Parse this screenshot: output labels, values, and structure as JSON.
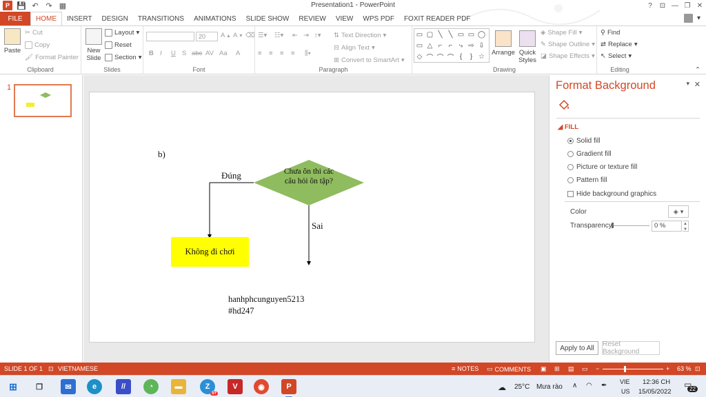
{
  "window": {
    "title": "Presentation1 - PowerPoint",
    "logo_letter": "P",
    "controls": [
      "?",
      "⊡",
      "—",
      "❐",
      "✕"
    ]
  },
  "quick_access": [
    "💾",
    "↶",
    "↷",
    "▦"
  ],
  "tabs": [
    "FILE",
    "HOME",
    "INSERT",
    "DESIGN",
    "TRANSITIONS",
    "ANIMATIONS",
    "SLIDE SHOW",
    "REVIEW",
    "VIEW",
    "WPS PDF",
    "FOXIT READER PDF"
  ],
  "active_tab": "HOME",
  "ribbon": {
    "clipboard": {
      "label": "Clipboard",
      "paste": "Paste",
      "cut": "Cut",
      "copy": "Copy",
      "format_painter": "Format Painter"
    },
    "slides": {
      "label": "Slides",
      "new_slide": "New Slide",
      "layout": "Layout",
      "reset": "Reset",
      "section": "Section"
    },
    "font": {
      "label": "Font",
      "size": "20",
      "buttons": [
        "B",
        "I",
        "U",
        "S",
        "abc",
        "AV",
        "Aa",
        "A"
      ]
    },
    "paragraph": {
      "label": "Paragraph",
      "text_direction": "Text Direction",
      "align_text": "Align Text",
      "smartart": "Convert to SmartArt"
    },
    "drawing": {
      "label": "Drawing",
      "arrange": "Arrange",
      "quick_styles": "Quick Styles",
      "shape_fill": "Shape Fill",
      "shape_outline": "Shape Outline",
      "shape_effects": "Shape Effects",
      "shapes": [
        "▭",
        "▢",
        "╲",
        "╲",
        "▭",
        "▭",
        "◯",
        "▭",
        "△",
        "⌐",
        "⌐",
        "⤷",
        "⇨",
        "⇩",
        "◇",
        "⌒",
        "⌒",
        "⌒",
        "{",
        "}",
        "☆"
      ]
    },
    "editing": {
      "label": "Editing",
      "find": "Find",
      "replace": "Replace",
      "select": "Select"
    }
  },
  "thumbnails": {
    "slide_number": "1"
  },
  "slide": {
    "label_b": "b)",
    "decision_text": "Chưa ôn thi các câu hỏi ôn tập?",
    "yes_label": "Đúng",
    "no_label": "Sai",
    "result_box": "Không đi chơi",
    "watermark_user": "hanhphcunguyen5213",
    "watermark_tag": "#hd247",
    "colors": {
      "diamond": "#8fbc5e",
      "box": "#ffff00"
    }
  },
  "format_pane": {
    "title": "Format Background",
    "section": "FILL",
    "options": [
      "Solid fill",
      "Gradient fill",
      "Picture or texture fill",
      "Pattern fill"
    ],
    "selected_option": "Solid fill",
    "hide_graphics": "Hide background graphics",
    "color_label": "Color",
    "transparency_label": "Transparency",
    "transparency_value": "0 %",
    "transparency_fraction": 0.0,
    "apply_all": "Apply to All",
    "reset_bg": "Reset Background"
  },
  "status": {
    "slide_of": "SLIDE 1 OF 1",
    "language": "VIETNAMESE",
    "notes": "NOTES",
    "comments": "COMMENTS",
    "zoom": "63 %"
  },
  "taskbar": {
    "weather_temp": "25°C",
    "weather_text": "Mưa rào",
    "lang_line1": "VIE",
    "lang_line2": "US",
    "time": "12:36 CH",
    "date": "15/05/2022",
    "notif_count": "22",
    "badge_5": "5+"
  },
  "accent_color": "#d24726"
}
